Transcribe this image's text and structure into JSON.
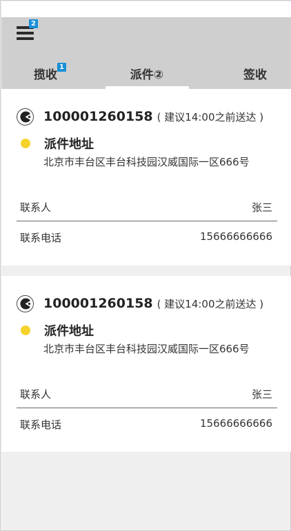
{
  "header": {
    "menu_badge": "2",
    "tabs": [
      {
        "label": "揽收",
        "badge": "1"
      },
      {
        "label": "派件②"
      },
      {
        "label": "签收"
      }
    ]
  },
  "cards": [
    {
      "tracking_no": "100001260158",
      "hint": "( 建议14:00之前送达 )",
      "address_title": "派件地址",
      "address": "北京市丰台区丰台科技园汉威国际一区666号",
      "contact_label": "联系人",
      "contact_value": "张三",
      "phone_label": "联系电话",
      "phone_value": "15666666666"
    },
    {
      "tracking_no": "100001260158",
      "hint": "( 建议14:00之前送达 )",
      "address_title": "派件地址",
      "address": "北京市丰台区丰台科技园汉威国际一区666号",
      "contact_label": "联系人",
      "contact_value": "张三",
      "phone_label": "联系电话",
      "phone_value": "15666666666"
    }
  ],
  "colors": {
    "header_bg": "#cfcfcf",
    "badge": "#1a8fd8",
    "address_dot": "#f6d22c"
  }
}
